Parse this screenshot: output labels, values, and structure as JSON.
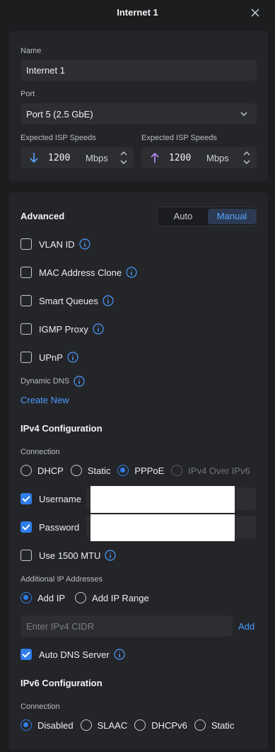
{
  "dialog": {
    "title": "Internet 1"
  },
  "general": {
    "name_label": "Name",
    "name_value": "Internet 1",
    "port_label": "Port",
    "port_value": "Port 5 (2.5 GbE)",
    "download": {
      "label": "Expected ISP Speeds",
      "value": "1200",
      "unit": "Mbps"
    },
    "upload": {
      "label": "Expected ISP Speeds",
      "value": "1200",
      "unit": "Mbps"
    }
  },
  "advanced": {
    "title": "Advanced",
    "mode_options": [
      "Auto",
      "Manual"
    ],
    "mode_selected": "Manual",
    "options": [
      {
        "label": "VLAN ID",
        "checked": false
      },
      {
        "label": "MAC Address Clone",
        "checked": false
      },
      {
        "label": "Smart Queues",
        "checked": false
      },
      {
        "label": "IGMP Proxy",
        "checked": false
      },
      {
        "label": "UPnP",
        "checked": false
      }
    ],
    "dynamic_dns_label": "Dynamic DNS",
    "create_new": "Create New"
  },
  "ipv4": {
    "title": "IPv4 Configuration",
    "connection_label": "Connection",
    "connection_options": [
      "DHCP",
      "Static",
      "PPPoE",
      "IPv4 Over IPv6"
    ],
    "connection_selected": "PPPoE",
    "username_label": "Username",
    "password_label": "Password",
    "mtu_label": "Use 1500 MTU",
    "additional_label": "Additional IP Addresses",
    "add_ip": "Add IP",
    "add_ip_range": "Add IP Range",
    "cidr_placeholder": "Enter IPv4 CIDR",
    "add_button": "Add",
    "auto_dns_label": "Auto DNS Server"
  },
  "ipv6": {
    "title": "IPv6 Configuration",
    "connection_label": "Connection",
    "connection_options": [
      "Disabled",
      "SLAAC",
      "DHCPv6",
      "Static"
    ],
    "connection_selected": "Disabled"
  },
  "colors": {
    "accent": "#2f7eeb",
    "link": "#4a9bff",
    "card": "#242528",
    "background": "#1c1d1f"
  },
  "icons": {
    "close": "close-icon",
    "chevron": "chevron-down-icon",
    "info": "info-icon",
    "download": "arrow-down-icon",
    "upload": "arrow-up-icon"
  }
}
